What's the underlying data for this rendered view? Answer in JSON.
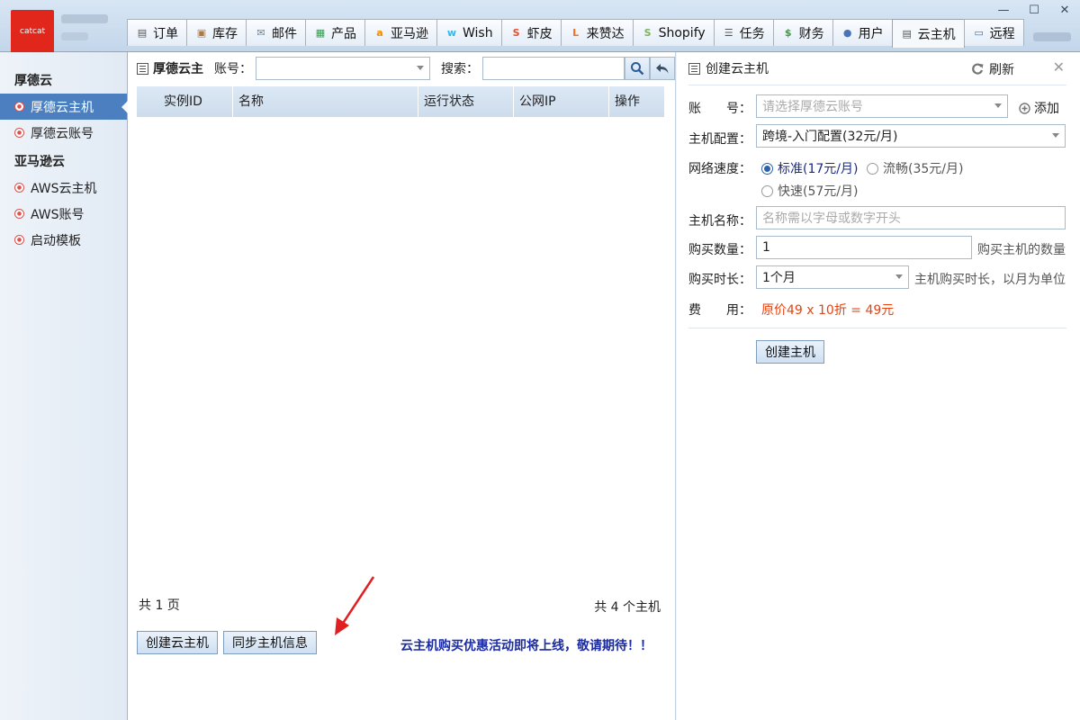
{
  "app": {
    "logo_text": "catcat"
  },
  "tabs": [
    {
      "label": "订单",
      "icon": "clipboard-icon",
      "color": "#555555"
    },
    {
      "label": "库存",
      "icon": "box-icon",
      "color": "#b07a3c"
    },
    {
      "label": "邮件",
      "icon": "mail-icon",
      "color": "#6a7f95"
    },
    {
      "label": "产品",
      "icon": "grid-icon",
      "color": "#2e9e4b"
    },
    {
      "label": "亚马逊",
      "icon": "amazon-icon",
      "color": "#f08c00"
    },
    {
      "label": "Wish",
      "icon": "wish-icon",
      "color": "#2fb7ec"
    },
    {
      "label": "虾皮",
      "icon": "shopee-icon",
      "color": "#ee4d2d"
    },
    {
      "label": "来赞达",
      "icon": "lazada-icon",
      "color": "#f36f21"
    },
    {
      "label": "Shopify",
      "icon": "shopify-icon",
      "color": "#7ab55c"
    },
    {
      "label": "任务",
      "icon": "task-icon",
      "color": "#555555"
    },
    {
      "label": "财务",
      "icon": "money-icon",
      "color": "#3d9b3d"
    },
    {
      "label": "用户",
      "icon": "user-icon",
      "color": "#4b74b8"
    },
    {
      "label": "云主机",
      "icon": "server-icon",
      "color": "#555555",
      "active": true
    },
    {
      "label": "远程",
      "icon": "remote-icon",
      "color": "#3a6fb0"
    }
  ],
  "window": {
    "minimize": "—",
    "maximize": "☐",
    "close": "✕"
  },
  "sidebar": {
    "groups": [
      {
        "title": "厚德云",
        "items": [
          {
            "label": "厚德云主机",
            "active": true
          },
          {
            "label": "厚德云账号"
          }
        ]
      },
      {
        "title": "亚马逊云",
        "items": [
          {
            "label": "AWS云主机"
          },
          {
            "label": "AWS账号"
          },
          {
            "label": "启动模板"
          }
        ]
      }
    ]
  },
  "center": {
    "title": "厚德云主",
    "account_label": "账号：",
    "account_value": "",
    "search_label": "搜索：",
    "search_value": "",
    "columns": [
      "实例ID",
      "名称",
      "运行状态",
      "公网IP",
      "操作"
    ],
    "rows": [],
    "total_pages": "共 1 页",
    "total_hosts": "共 4 个主机",
    "create_button": "创建云主机",
    "sync_button": "同步主机信息",
    "promo": "云主机购买优惠活动即将上线，敬请期待！！",
    "accent": "#1a2ba3"
  },
  "form": {
    "title": "创建云主机",
    "refresh": "刷新",
    "account_label": "账　　号：",
    "account_placeholder": "请选择厚德云账号",
    "add_label": "添加",
    "config_label": "主机配置：",
    "config_value": "跨境-入门配置(32元/月)",
    "speed_label": "网络速度：",
    "speeds": [
      {
        "label": "标准(17元/月)",
        "selected": true
      },
      {
        "label": "流畅(35元/月)",
        "selected": false
      },
      {
        "label": "快速(57元/月)",
        "selected": false
      }
    ],
    "name_label": "主机名称：",
    "name_placeholder": "名称需以字母或数字开头",
    "qty_label": "购买数量：",
    "qty_value": "1",
    "qty_hint": "购买主机的数量",
    "duration_label": "购买时长：",
    "duration_value": "1个月",
    "duration_hint": "主机购买时长，以月为单位",
    "fee_label": "费　　用：",
    "fee_value": "原价49 x 10折 = 49元",
    "fee_color": "#e8420e",
    "submit": "创建主机"
  }
}
